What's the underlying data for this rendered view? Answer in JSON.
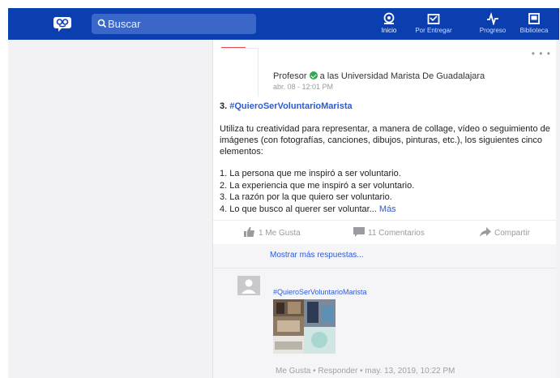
{
  "topbar": {
    "search_placeholder": "Buscar",
    "nav": [
      {
        "label": "Inicio",
        "icon": "home-icon",
        "active": true
      },
      {
        "label": "Por Entregar",
        "icon": "inbox-icon",
        "active": false
      },
      {
        "label": "Progreso",
        "icon": "pulse-icon",
        "active": false
      },
      {
        "label": "Biblioteca",
        "icon": "library-icon",
        "active": false
      }
    ],
    "colors": {
      "bar": "#0b3fb0",
      "search": "#3b68c8"
    }
  },
  "post": {
    "author_prefix": "Profesor",
    "author_suffix": "a las Universidad Marista De Guadalajara",
    "timestamp": "abr. 08 - 12:01 PM",
    "title_number": "3.",
    "title_tag": "#QuieroSerVoluntarioMarista",
    "body": "Utiliza tu creatividad para representar, a manera de collage, vídeo o seguimiento de imágenes (con fotografías, canciones, dibujos, pinturas, etc.), los siguientes cinco elementos:",
    "list": [
      "1. La persona que me inspiró a ser voluntario.",
      "2. La experiencia que me inspiró a ser voluntario.",
      "3. La razón por la que quiero ser voluntario.",
      "4. Lo que busco al querer ser voluntar..."
    ],
    "more_link": "Más",
    "actions": {
      "like": "1 Me Gusta",
      "comments": "11 Comentarios",
      "share": "Compartir"
    }
  },
  "replies": {
    "show_more": "Mostrar más respuestas...",
    "reply_tag": "#QuieroSerVoluntarioMarista",
    "meta": "Me Gusta  •  Responder  •  may. 13, 2019, 10:22 PM"
  }
}
